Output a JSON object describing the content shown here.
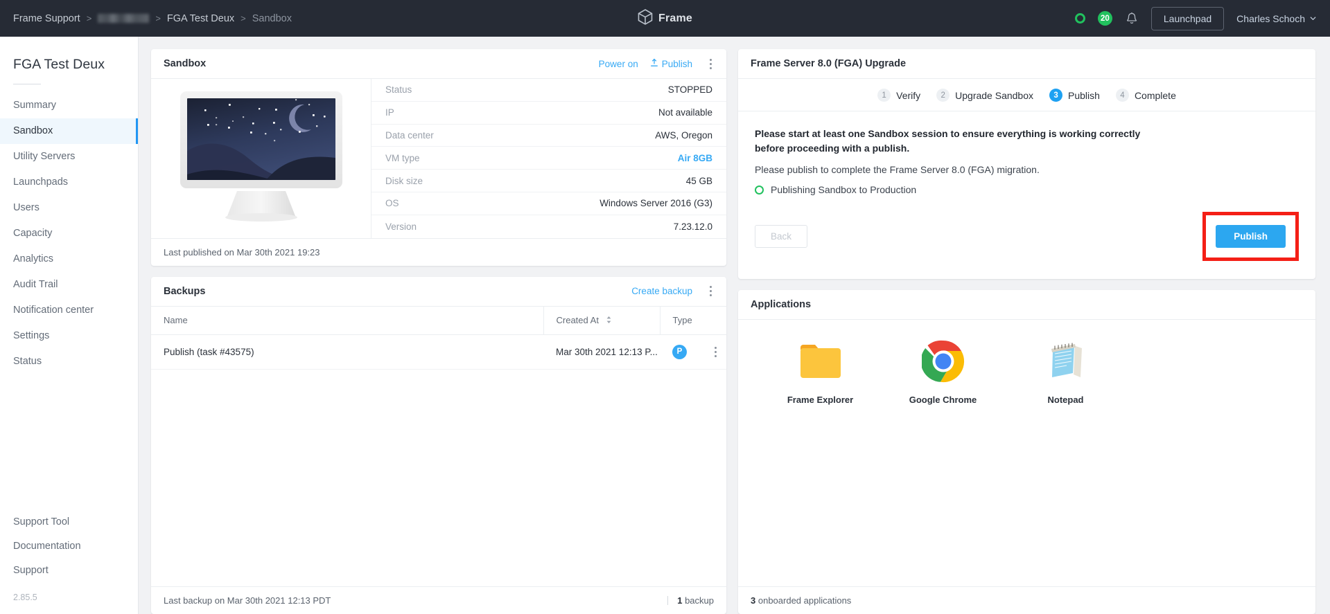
{
  "topbar": {
    "breadcrumb": [
      {
        "label": "Frame Support",
        "type": "link"
      },
      {
        "label": "",
        "type": "redacted"
      },
      {
        "label": "FGA Test Deux",
        "type": "link"
      },
      {
        "label": "Sandbox",
        "type": "current"
      }
    ],
    "separator": ">",
    "brand_name": "Frame",
    "brand_icon": "cube-icon",
    "status_icon": "status-ring-icon",
    "notification_count": "20",
    "bell_icon": "bell-icon",
    "launchpad_label": "Launchpad",
    "user_name": "Charles Schoch",
    "user_caret_icon": "chevron-down-icon",
    "accent_green": "#21c15e",
    "bar_bg": "#262b35"
  },
  "sidebar": {
    "org_title": "FGA Test Deux",
    "items": [
      {
        "label": "Summary",
        "active": false
      },
      {
        "label": "Sandbox",
        "active": true
      },
      {
        "label": "Utility Servers",
        "active": false
      },
      {
        "label": "Launchpads",
        "active": false
      },
      {
        "label": "Users",
        "active": false
      },
      {
        "label": "Capacity",
        "active": false
      },
      {
        "label": "Analytics",
        "active": false
      },
      {
        "label": "Audit Trail",
        "active": false
      },
      {
        "label": "Notification center",
        "active": false
      },
      {
        "label": "Settings",
        "active": false
      },
      {
        "label": "Status",
        "active": false
      }
    ],
    "bottom_items": [
      {
        "label": "Support Tool"
      },
      {
        "label": "Documentation"
      },
      {
        "label": "Support"
      }
    ],
    "version": "2.85.5",
    "active_color": "#2196f3"
  },
  "sandbox_card": {
    "title": "Sandbox",
    "power_on_label": "Power on",
    "publish_label": "Publish",
    "publish_icon": "upload-icon",
    "kebab_icon": "kebab-menu-icon",
    "thumbnail_icon": "monitor-night-sky-thumbnail",
    "info_rows": [
      {
        "key": "Status",
        "value": "STOPPED",
        "is_link": false
      },
      {
        "key": "IP",
        "value": "Not available",
        "is_link": false
      },
      {
        "key": "Data center",
        "value": "AWS, Oregon",
        "is_link": false
      },
      {
        "key": "VM type",
        "value": "Air 8GB",
        "is_link": true
      },
      {
        "key": "Disk size",
        "value": "45 GB",
        "is_link": false
      },
      {
        "key": "OS",
        "value": "Windows Server 2016 (G3)",
        "is_link": false
      },
      {
        "key": "Version",
        "value": "7.23.12.0",
        "is_link": false
      }
    ],
    "footer": "Last published on Mar 30th 2021 19:23"
  },
  "backups_card": {
    "title": "Backups",
    "create_label": "Create backup",
    "kebab_icon": "kebab-menu-icon",
    "columns": [
      "Name",
      "Created At",
      "Type"
    ],
    "sort_icon": "sort-arrows-icon",
    "rows": [
      {
        "name": "Publish (task #43575)",
        "created_at": "Mar 30th 2021 12:13 P...",
        "type_badge": "P"
      }
    ],
    "footer_left": "Last backup on Mar 30th 2021 12:13 PDT",
    "footer_count": "1",
    "footer_count_label": "backup"
  },
  "upgrade_card": {
    "title": "Frame Server 8.0 (FGA) Upgrade",
    "steps": [
      {
        "num": "1",
        "label": "Verify",
        "active": false
      },
      {
        "num": "2",
        "label": "Upgrade Sandbox",
        "active": false
      },
      {
        "num": "3",
        "label": "Publish",
        "active": true
      },
      {
        "num": "4",
        "label": "Complete",
        "active": false
      }
    ],
    "bold_message": "Please start at least one Sandbox session to ensure everything is working correctly before proceeding with a publish.",
    "note": "Please publish to complete the Frame Server 8.0 (FGA) migration.",
    "progress_icon": "progress-ring-icon",
    "progress_text": "Publishing Sandbox to Production",
    "back_label": "Back",
    "publish_label": "Publish",
    "highlight_color": "#f41f16",
    "publish_button_color": "#2ca7f0"
  },
  "applications_card": {
    "title": "Applications",
    "apps": [
      {
        "label": "Frame Explorer",
        "icon": "folder-icon"
      },
      {
        "label": "Google Chrome",
        "icon": "chrome-icon"
      },
      {
        "label": "Notepad",
        "icon": "notepad-icon"
      }
    ],
    "footer_count": "3",
    "footer_label": "onboarded applications"
  }
}
